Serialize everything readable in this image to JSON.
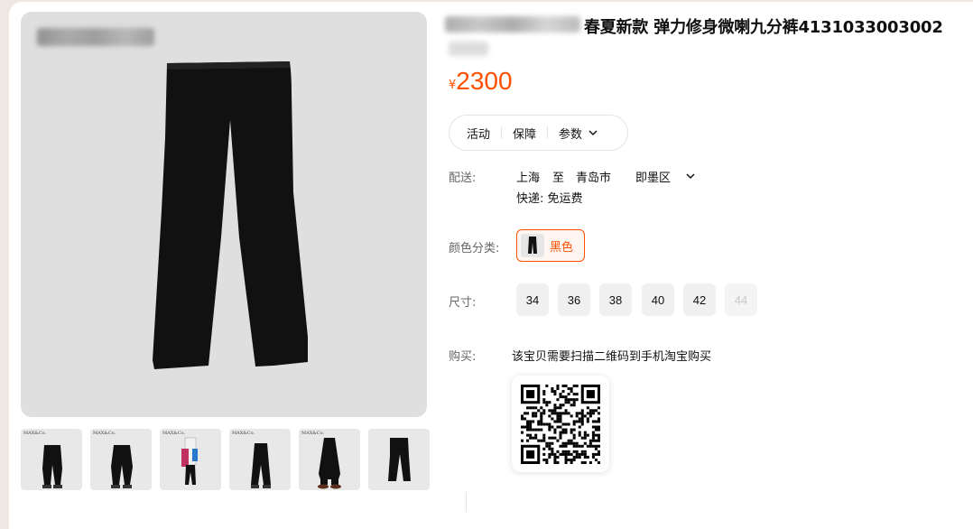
{
  "product": {
    "title": "春夏新款 弹力修身微喇九分裤4131033003002",
    "currency": "¥",
    "price": "2300"
  },
  "tabs": [
    {
      "label": "活动"
    },
    {
      "label": "保障"
    },
    {
      "label": "参数"
    }
  ],
  "delivery": {
    "label": "配送:",
    "from": "上海",
    "to_word": "至",
    "city": "青岛市",
    "district": "即墨区",
    "shipping": "快递: 免运费"
  },
  "color": {
    "label": "颜色分类:",
    "selected": "黑色"
  },
  "size": {
    "label": "尺寸:",
    "options": [
      {
        "value": "34",
        "available": true
      },
      {
        "value": "36",
        "available": true
      },
      {
        "value": "38",
        "available": true
      },
      {
        "value": "40",
        "available": true
      },
      {
        "value": "42",
        "available": true
      },
      {
        "value": "44",
        "available": false
      }
    ]
  },
  "buy": {
    "label": "购买:",
    "notice": "该宝贝需要扫描二维码到手机淘宝购买"
  },
  "colors": {
    "accent": "#ff5000",
    "image_bg": "#dfdfdf",
    "page_bg": "#efe7e2"
  },
  "icons": [
    "chevron-down-icon",
    "qr-code-icon"
  ]
}
